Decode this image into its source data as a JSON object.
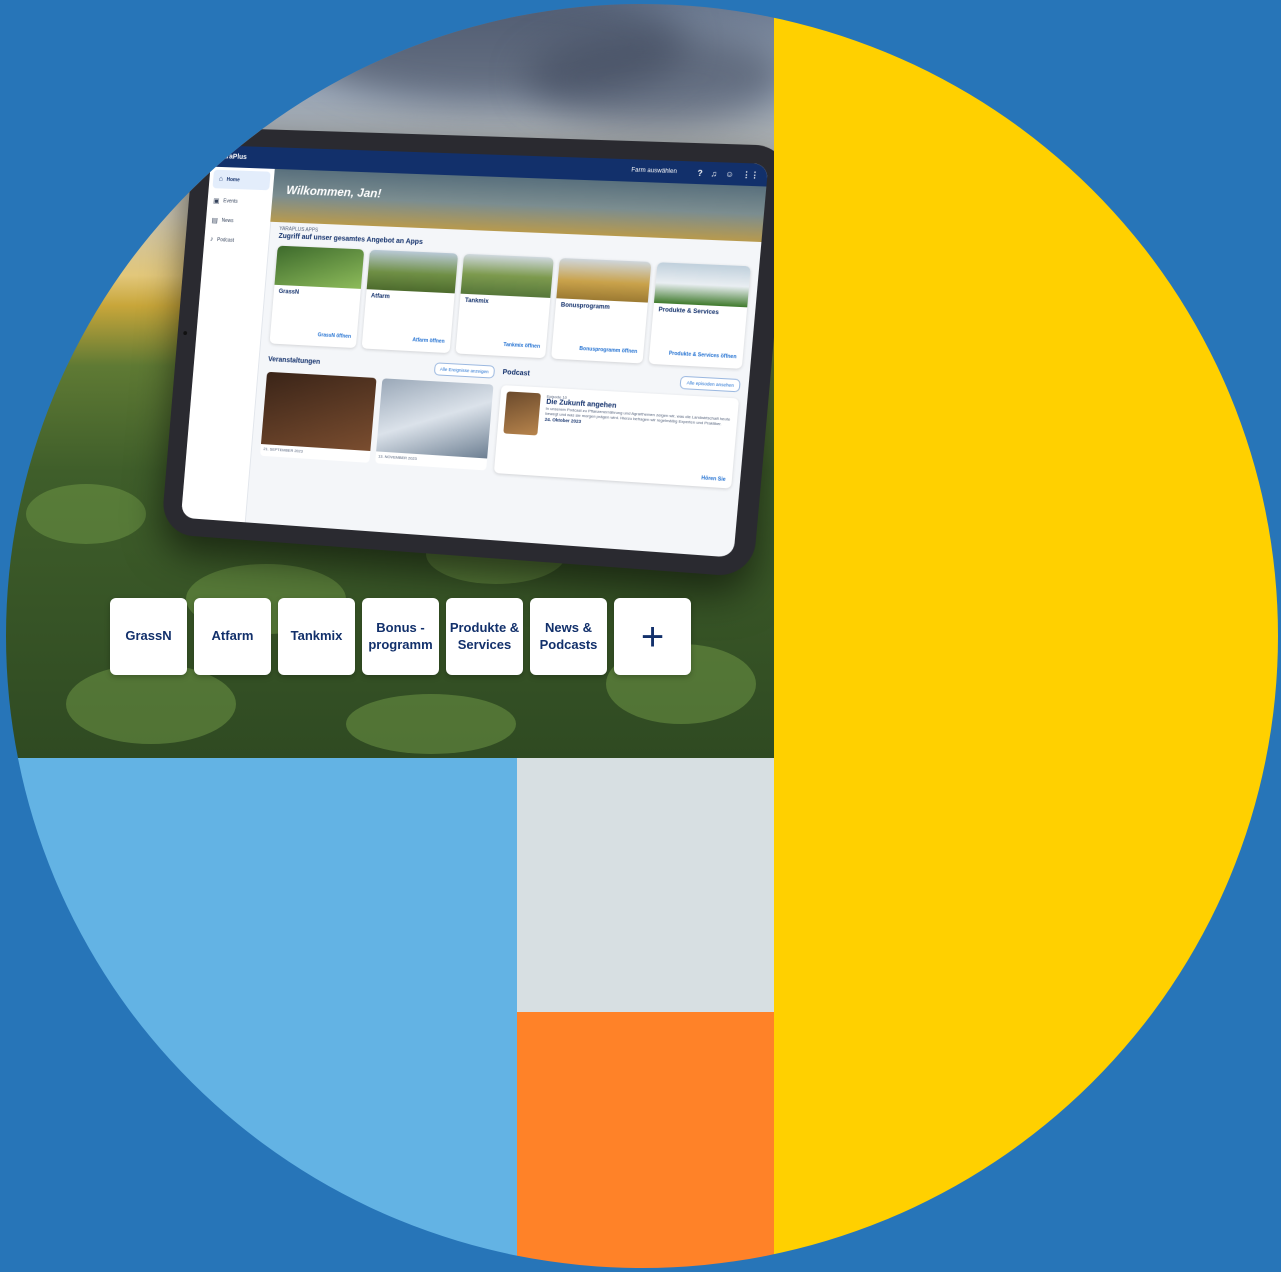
{
  "tablet": {
    "brand": "YaraPlus",
    "farm_label": "Farm auswählen",
    "sidebar": [
      "Home",
      "Events",
      "News",
      "Podcast"
    ],
    "hero_title": "Wilkommen, Jan!",
    "apps_kicker": "YARAPLUS APPS",
    "apps_title": "Zugriff auf unser gesamtes Angebot an Apps",
    "apps": [
      {
        "name": "GrassN",
        "link": "GrassN öffnen"
      },
      {
        "name": "Atfarm",
        "link": "Atfarm öffnen"
      },
      {
        "name": "Tankmix",
        "link": "Tankmix öffnen"
      },
      {
        "name": "Bonusprogramm",
        "link": "Bonusprogramm öffnen"
      },
      {
        "name": "Produkte & Services",
        "link": "Produkte & Services öffnen"
      }
    ],
    "events_title": "Veranstaltungen",
    "events_button": "Alle Ereignisse anzeigen",
    "events": [
      {
        "date": "21. SEPTEMBER 2023"
      },
      {
        "date": "13. NOVEMBER 2023"
      }
    ],
    "podcast_title": "Podcast",
    "podcast_button": "Alle episoden ansehen",
    "podcast": {
      "episode": "Episode 10",
      "title": "Die Zukunft angehen",
      "desc": "In unserem Podcast zu Pflanzenernährung und Agrarthemen zeigen wir, was die Landwirtschaft heute bewegt und was sie morgen prägen wird. Hierzu befragen wir regelmäßig Experten und Praktiker.",
      "date": "24. Oktober 2023",
      "listen": "Hören Sie"
    }
  },
  "tiles": [
    "GrassN",
    "Atfarm",
    "Tankmix",
    "Bonus - programm",
    "Produkte & Services",
    "News & Podcasts",
    "+"
  ],
  "colors": {
    "background": "#2775b8",
    "yellow": "#ffd000",
    "light_blue": "#63b3e4",
    "grey": "#d7dfe2",
    "orange": "#ff8228",
    "navy": "#12306b"
  }
}
